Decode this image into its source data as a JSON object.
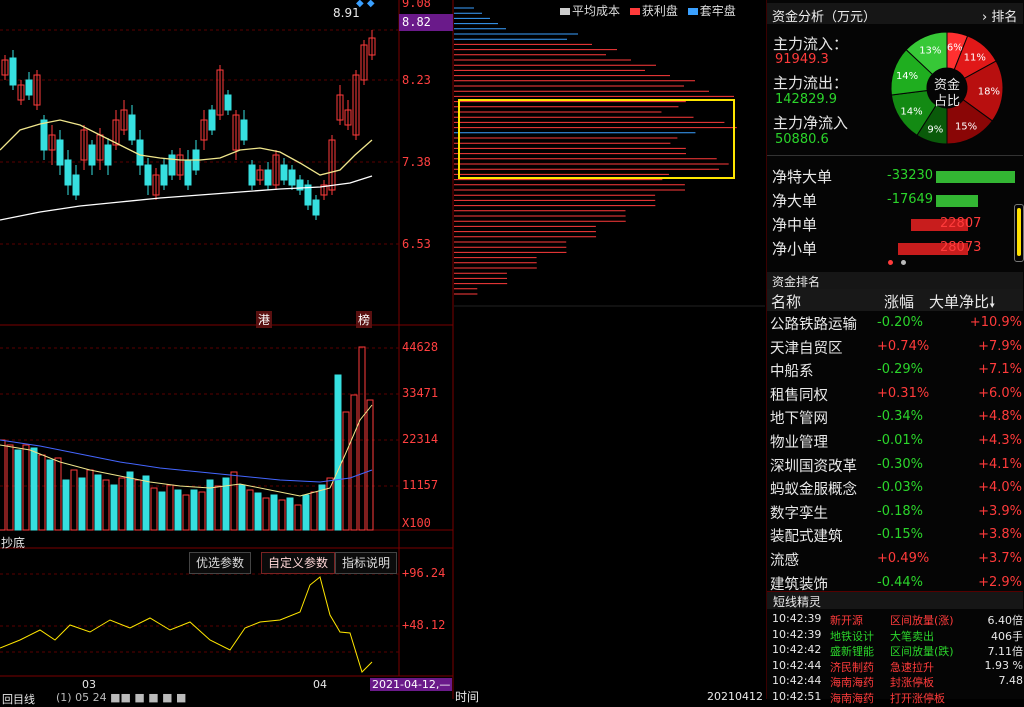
{
  "kline": {
    "price_labels": [
      "8.82",
      "8.23",
      "7.38",
      "6.53"
    ],
    "top_price_label": "9.08",
    "marker_value": "8.91",
    "tags": [
      "港",
      "榜"
    ]
  },
  "volume": {
    "labels": [
      "44628",
      "33471",
      "22314",
      "11157",
      "X100"
    ]
  },
  "indicator": {
    "name": "抄底",
    "tabs": [
      "优选参数",
      "自定义参数",
      "指标说明"
    ],
    "labels": [
      "+96.24",
      "+48.12"
    ]
  },
  "x_axis": {
    "months": [
      "03",
      "04"
    ],
    "cursor_date": "2021-04-12,—",
    "bottom_left": "回目线",
    "bottom_left2": "(1)  05   24 ■■ ■ ■ ■ ■"
  },
  "chips": {
    "legend": [
      {
        "label": "平均成本",
        "color": "#cccccc"
      },
      {
        "label": "获利盘",
        "color": "#ff3b3b"
      },
      {
        "label": "套牢盘",
        "color": "#3aa0ff"
      }
    ],
    "bottom_time": "时间",
    "bottom_date": "20210412"
  },
  "fund": {
    "title": "资金分析（万元）",
    "rank_btn": "排名",
    "inflow_label": "主力流入：",
    "inflow_value": "91949.3",
    "outflow_label": "主力流出：",
    "outflow_value": "142829.9",
    "net_label": "主力净流入",
    "net_value": "50880.6",
    "donut_center_1": "资金",
    "donut_center_2": "占比",
    "donut": [
      {
        "pct": 6,
        "label": "6%",
        "color": "#ff3030"
      },
      {
        "pct": 11,
        "label": "11%",
        "color": "#e01818"
      },
      {
        "pct": 18,
        "label": "18%",
        "color": "#b80f0f"
      },
      {
        "pct": 15,
        "label": "15%",
        "color": "#8a0606"
      },
      {
        "pct": 9,
        "label": "9%",
        "color": "#0a5a0a"
      },
      {
        "pct": 14,
        "label": "14%",
        "color": "#138a13"
      },
      {
        "pct": 14,
        "label": "14%",
        "color": "#1fae1f"
      },
      {
        "pct": 13,
        "label": "13%",
        "color": "#37c837"
      }
    ],
    "flows": [
      {
        "label": "净特大单",
        "value": "-33230",
        "color": "#2bd52b"
      },
      {
        "label": "净大单",
        "value": "-17649",
        "color": "#2bd52b"
      },
      {
        "label": "净中单",
        "value": "22807",
        "color": "#ff3b3b"
      },
      {
        "label": "净小单",
        "value": "28073",
        "color": "#ff3b3b"
      }
    ],
    "flow_levels": [
      0.92,
      0.49,
      0.63,
      0.78
    ]
  },
  "ranking": {
    "title": "资金排名",
    "headers": [
      "名称",
      "涨幅",
      "大单净比"
    ],
    "rows": [
      {
        "name": "公路铁路运输",
        "change": "-0.20%",
        "net": "+10.9%"
      },
      {
        "name": "天津自贸区",
        "change": "+0.74%",
        "net": "+7.9%"
      },
      {
        "name": "中船系",
        "change": "-0.29%",
        "net": "+7.1%"
      },
      {
        "name": "租售同权",
        "change": "+0.31%",
        "net": "+6.0%"
      },
      {
        "name": "地下管网",
        "change": "-0.34%",
        "net": "+4.8%"
      },
      {
        "name": "物业管理",
        "change": "-0.01%",
        "net": "+4.3%"
      },
      {
        "name": "深圳国资改革",
        "change": "-0.30%",
        "net": "+4.1%"
      },
      {
        "name": "蚂蚁金服概念",
        "change": "-0.03%",
        "net": "+4.0%"
      },
      {
        "name": "数字孪生",
        "change": "-0.18%",
        "net": "+3.9%"
      },
      {
        "name": "装配式建筑",
        "change": "-0.15%",
        "net": "+3.8%"
      },
      {
        "name": "流感",
        "change": "+0.49%",
        "net": "+3.7%"
      },
      {
        "name": "建筑装饰",
        "change": "-0.44%",
        "net": "+2.9%"
      }
    ]
  },
  "short": {
    "title": "短线精灵",
    "rows": [
      {
        "time": "10:42:39",
        "name": "新开源",
        "event": "区间放量(涨)",
        "value": "6.40倍",
        "color": "#ff3b3b"
      },
      {
        "time": "10:42:39",
        "name": "地铁设计",
        "event": "大笔卖出",
        "value": "406手",
        "color": "#2bd52b"
      },
      {
        "time": "10:42:42",
        "name": "盛新锂能",
        "event": "区间放量(跌)",
        "value": "7.11倍",
        "color": "#2bd52b"
      },
      {
        "time": "10:42:44",
        "name": "济民制药",
        "event": "急速拉升",
        "value": "1.93 %",
        "color": "#ff3b3b"
      },
      {
        "time": "10:42:44",
        "name": "海南海药",
        "event": "封涨停板",
        "value": "7.48",
        "color": "#ff3b3b"
      },
      {
        "time": "10:42:51",
        "name": "海南海药",
        "event": "打开涨停板",
        "value": "",
        "color": "#ff3b3b"
      }
    ]
  }
}
